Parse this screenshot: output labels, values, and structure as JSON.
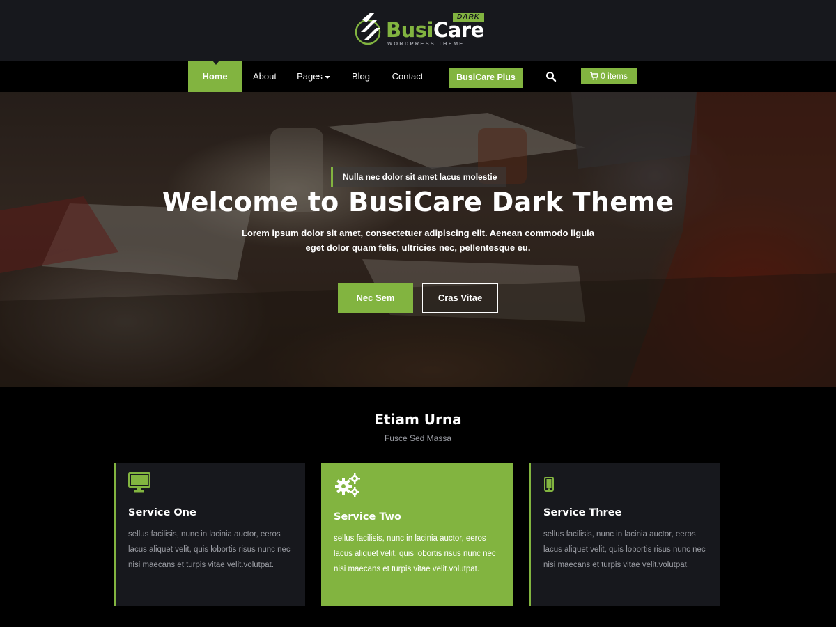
{
  "brand": {
    "name_part1": "Busi",
    "name_part2": "Care",
    "badge": "DARK",
    "tagline": "WORDPRESS THEME"
  },
  "nav": {
    "items": [
      {
        "label": "Home",
        "active": true
      },
      {
        "label": "About"
      },
      {
        "label": "Pages",
        "has_dropdown": true
      },
      {
        "label": "Blog"
      },
      {
        "label": "Contact"
      }
    ],
    "plus_label": "BusiCare Plus",
    "cart_label": "0 items",
    "search_icon": "search-icon",
    "cart_icon": "shopping-cart-icon"
  },
  "hero": {
    "kicker": "Nulla nec dolor sit amet lacus molestie",
    "title": "Welcome to BusiCare Dark Theme",
    "description": "Lorem ipsum dolor sit amet, consectetuer adipiscing elit. Aenean commodo ligula eget dolor quam felis, ultricies nec, pellentesque eu.",
    "primary_button": "Nec Sem",
    "secondary_button": "Cras Vitae"
  },
  "services": {
    "title": "Etiam Urna",
    "subtitle": "Fusce Sed Massa",
    "cards": [
      {
        "icon": "desktop-icon",
        "title": "Service One",
        "text": "sellus facilisis, nunc in lacinia auctor, eeros lacus aliquet velit, quis lobortis risus nunc nec nisi maecans et turpis vitae velit.volutpat."
      },
      {
        "icon": "gears-icon",
        "title": "Service Two",
        "text": "sellus facilisis, nunc in lacinia auctor, eeros lacus aliquet velit, quis lobortis risus nunc nec nisi maecans et turpis vitae velit.volutpat."
      },
      {
        "icon": "mobile-icon",
        "title": "Service Three",
        "text": "sellus facilisis, nunc in lacinia auctor, eeros lacus aliquet velit, quis lobortis risus nunc nec nisi maecans et turpis vitae velit.volutpat."
      }
    ]
  },
  "colors": {
    "accent": "#82b440",
    "header_bg": "#17181d",
    "page_bg": "#000000",
    "card_bg": "#17181d",
    "muted_text": "#9a9ca3"
  }
}
